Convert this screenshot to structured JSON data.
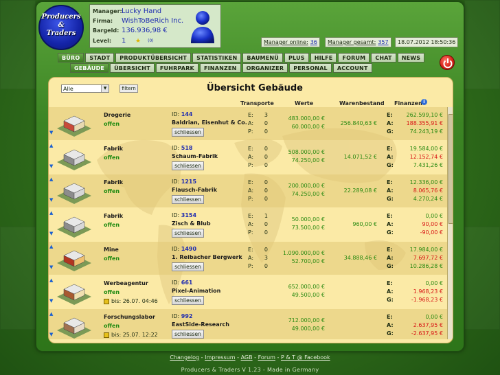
{
  "logo": {
    "line1": "Producers",
    "line2": "&",
    "line3": "Traders"
  },
  "manager_info": {
    "manager_key": "Manager:",
    "manager_val": "Lucky Hand",
    "firma_key": "Firma:",
    "firma_val": "WishToBeRich Inc.",
    "bargeld_key": "Bargeld:",
    "bargeld_val": "136.936,98 €",
    "level_key": "Level:",
    "level_val": "1",
    "level_extra": "(0)"
  },
  "status": {
    "online_label": "Manager online:",
    "online_val": "36",
    "total_label": "Manager gesamt:",
    "total_val": "357",
    "datetime": "18.07.2012 18:50:36"
  },
  "nav_main": [
    "BÜRO",
    "STADT",
    "PRODUKTÜBERSICHT",
    "STATISTIKEN",
    "BAUMENÜ",
    "PLUS",
    "HILFE",
    "FORUM",
    "CHAT",
    "NEWS"
  ],
  "nav_sub": [
    "GEBÄUDE",
    "ÜBERSICHT",
    "FUHRPARK",
    "FINANZEN",
    "ORGANIZER",
    "PERSONAL",
    "ACCOUNT"
  ],
  "filter": {
    "selected": "Alle",
    "button": "filtern"
  },
  "panel": {
    "title": "Übersicht Gebäude"
  },
  "columns": {
    "transporte": "Transporte",
    "werte": "Werte",
    "warenbestand": "Warenbestand",
    "finanzen": "Finanzen"
  },
  "buildings": [
    {
      "type": "Drogerie",
      "status": "offen",
      "id": "144",
      "name": "Baldrian, Eisenhut & Co.",
      "button": "schliessen",
      "E": "3",
      "A": "0",
      "P": "0",
      "wert1": "483.000,00 €",
      "wert2": "60.000,00 €",
      "stock": "256.840,63 €",
      "fE": "262.599,10 €",
      "fA": "188.355,91 €",
      "fG": "74.243,19 €",
      "timer": ""
    },
    {
      "type": "Fabrik",
      "status": "offen",
      "id": "518",
      "name": "Schaum-Fabrik",
      "button": "schliessen",
      "E": "0",
      "A": "0",
      "P": "0",
      "wert1": "508.000,00 €",
      "wert2": "74.250,00 €",
      "stock": "14.071,52 €",
      "fE": "19.584,00 €",
      "fA": "12.152,74 €",
      "fG": "7.431,26 €",
      "timer": ""
    },
    {
      "type": "Fabrik",
      "status": "offen",
      "id": "1215",
      "name": "Flausch-Fabrik",
      "button": "schliessen",
      "E": "0",
      "A": "0",
      "P": "0",
      "wert1": "200.000,00 €",
      "wert2": "74.250,00 €",
      "stock": "22.289,08 €",
      "fE": "12.336,00 €",
      "fA": "8.065,76 €",
      "fG": "4.270,24 €",
      "timer": ""
    },
    {
      "type": "Fabrik",
      "status": "offen",
      "id": "3154",
      "name": "Zisch & Blub",
      "button": "schliessen",
      "E": "1",
      "A": "0",
      "P": "0",
      "wert1": "50.000,00 €",
      "wert2": "73.500,00 €",
      "stock": "960,00 €",
      "fE": "0,00 €",
      "fA": "90,00 €",
      "fG": "-90,00 €",
      "timer": ""
    },
    {
      "type": "Mine",
      "status": "offen",
      "id": "1490",
      "name": "1. Reibacher Bergwerk",
      "button": "schliessen",
      "E": "0",
      "A": "3",
      "P": "0",
      "wert1": "1.090.000,00 €",
      "wert2": "52.700,00 €",
      "stock": "34.888,46 €",
      "fE": "17.984,00 €",
      "fA": "7.697,72 €",
      "fG": "10.286,28 €",
      "timer": ""
    },
    {
      "type": "Werbeagentur",
      "status": "offen",
      "id": "661",
      "name": "Pixel-Animation",
      "button": "schliessen",
      "E": "",
      "A": "",
      "P": "",
      "wert1": "652.000,00 €",
      "wert2": "49.500,00 €",
      "stock": "",
      "fE": "0,00 €",
      "fA": "1.968,23 €",
      "fG": "-1.968,23 €",
      "timer": "bis: 26.07. 04:46"
    },
    {
      "type": "Forschungslabor",
      "status": "offen",
      "id": "992",
      "name": "EastSide-Research",
      "button": "schliessen",
      "E": "",
      "A": "",
      "P": "",
      "wert1": "712.000,00 €",
      "wert2": "49.000,00 €",
      "stock": "",
      "fE": "0,00 €",
      "fA": "2.637,95 €",
      "fG": "-2.637,95 €",
      "timer": "bis: 25.07. 12:22"
    }
  ],
  "labels": {
    "id": "ID:",
    "E": "E:",
    "A": "A:",
    "P": "P:",
    "G": "G:"
  },
  "footer": {
    "links": [
      "Changelog",
      "Impressum",
      "AGB",
      "Forum",
      "P & T @ Facebook"
    ],
    "copyright": "Producers & Traders V 1.23 - Made in Germany"
  }
}
